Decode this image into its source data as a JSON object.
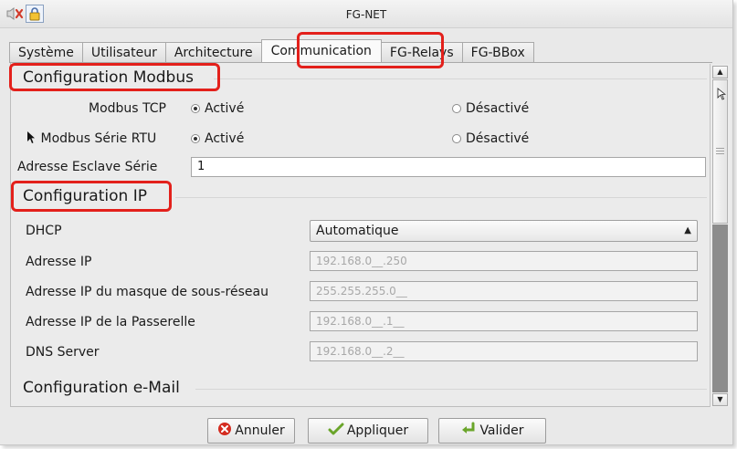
{
  "window": {
    "title": "FG-NET"
  },
  "tabs": [
    {
      "label": "Système"
    },
    {
      "label": "Utilisateur"
    },
    {
      "label": "Architecture"
    },
    {
      "label": "Communication"
    },
    {
      "label": "FG-Relays"
    },
    {
      "label": "FG-BBox"
    }
  ],
  "modbus": {
    "title": "Configuration Modbus",
    "tcp_label": "Modbus TCP",
    "rtu_label": "Modbus Série RTU",
    "on_label": "Activé",
    "off_label": "Désactivé",
    "slave_label": "Adresse Esclave Série",
    "slave_value": "1"
  },
  "ip": {
    "title": "Configuration IP",
    "dhcp_label": "DHCP",
    "dhcp_value": "Automatique",
    "ip_label": "Adresse IP",
    "ip_value": "192.168.0__.250",
    "mask_label": "Adresse IP du masque de sous-réseau",
    "mask_value": "255.255.255.0__",
    "gateway_label": "Adresse IP de la Passerelle",
    "gateway_value": "192.168.0__.1__",
    "dns_label": "DNS Server",
    "dns_value": "192.168.0__.2__"
  },
  "email": {
    "title": "Configuration e-Mail"
  },
  "buttons": {
    "cancel": "Annuler",
    "apply": "Appliquer",
    "ok": "Valider"
  },
  "colors": {
    "highlight": "#e3201b"
  }
}
